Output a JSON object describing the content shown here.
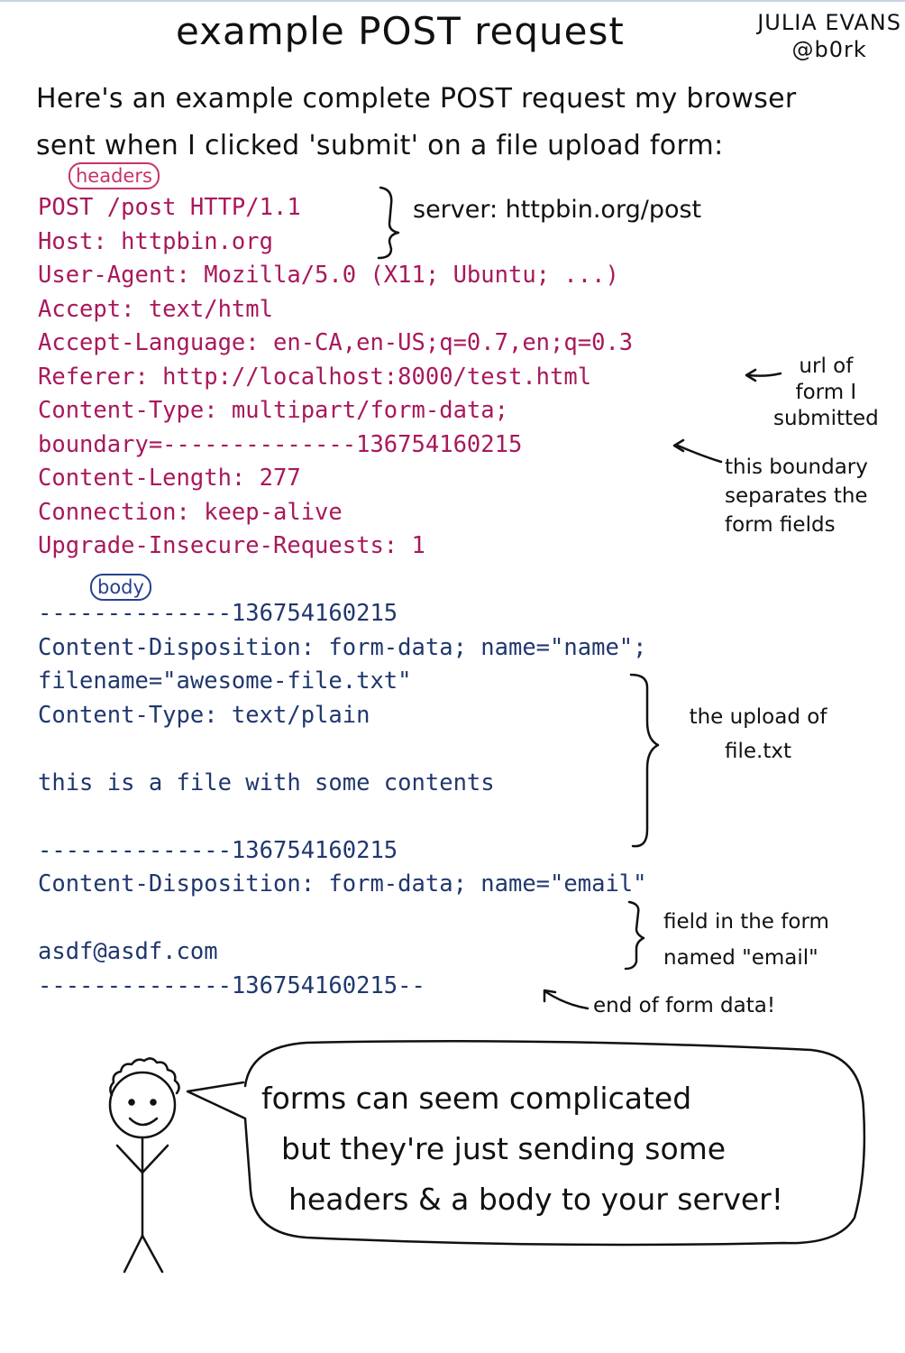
{
  "title": "example POST request",
  "author": {
    "name": "JULIA EVANS",
    "handle": "@b0rk"
  },
  "intro": [
    "Here's an example complete POST request my browser",
    "sent when I clicked 'submit' on a file upload form:"
  ],
  "tags": {
    "headers": "headers",
    "body": "body"
  },
  "header_lines": [
    "POST /post HTTP/1.1",
    "Host: httpbin.org",
    "User-Agent: Mozilla/5.0 (X11; Ubuntu; ...)",
    "Accept: text/html",
    "Accept-Language: en-CA,en-US;q=0.7,en;q=0.3",
    "Referer: http://localhost:8000/test.html",
    "Content-Type: multipart/form-data;",
    "boundary=--------------136754160215",
    "Content-Length: 277",
    "Connection: keep-alive",
    "Upgrade-Insecure-Requests: 1"
  ],
  "body_lines": [
    "--------------136754160215",
    "Content-Disposition: form-data; name=\"name\";",
    "filename=\"awesome-file.txt\"",
    "Content-Type: text/plain",
    "",
    "this is a file with some contents",
    "",
    "--------------136754160215",
    "Content-Disposition: form-data; name=\"email\"",
    "",
    "asdf@asdf.com",
    "--------------136754160215--"
  ],
  "annotations": {
    "server": "server: httpbin.org/post",
    "url_note": [
      "url of",
      "form I",
      "submitted"
    ],
    "boundary_note": [
      "this boundary",
      "separates the",
      "form fields"
    ],
    "upload_note": [
      "the upload of",
      "file.txt"
    ],
    "email_note": [
      "field in the form",
      "named \"email\""
    ],
    "end_note": "end of form data!"
  },
  "speech": [
    "forms can seem complicated",
    "but they're just sending some",
    "headers & a body to your server!"
  ],
  "colors": {
    "header_text": "#a8185c",
    "body_text": "#20376e",
    "headers_tag": "#c8336a"
  }
}
